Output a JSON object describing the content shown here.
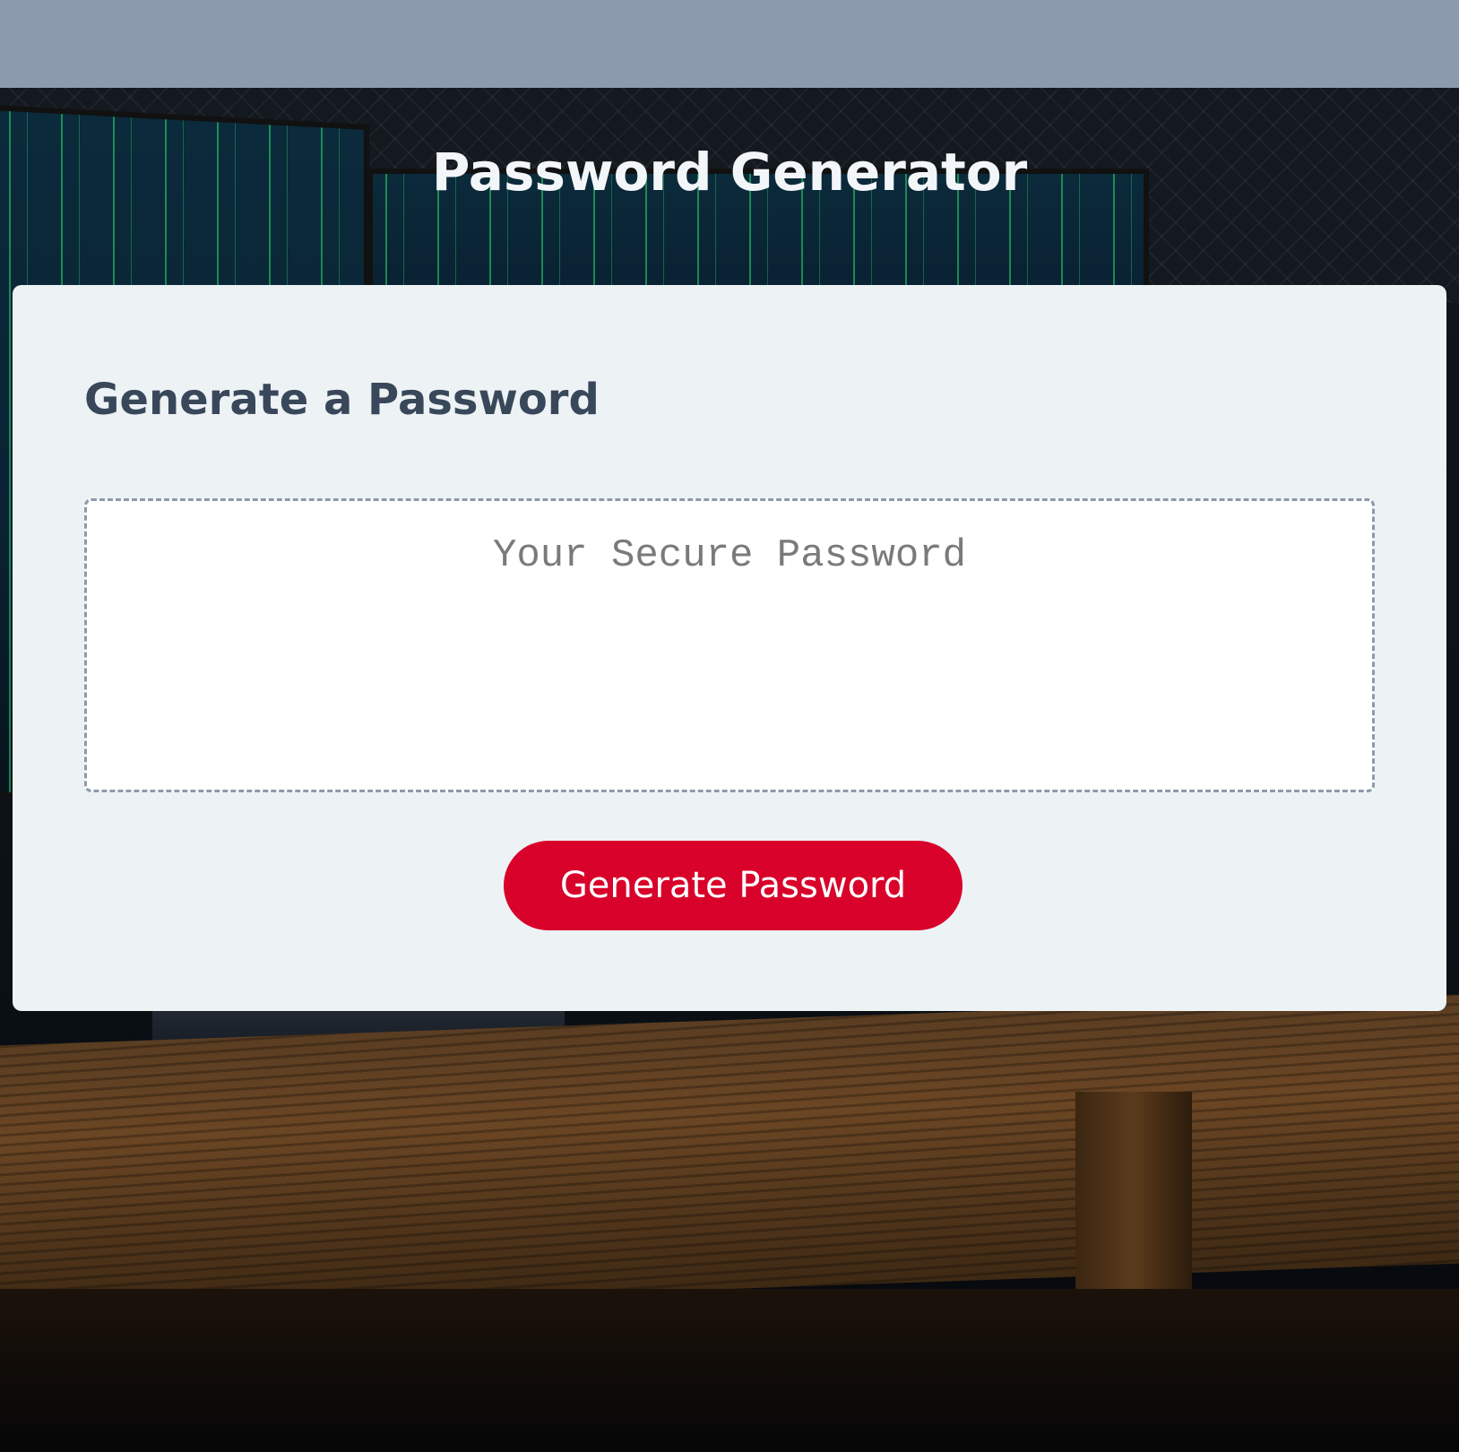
{
  "header": {
    "title": "Password Generator"
  },
  "card": {
    "heading": "Generate a Password",
    "password_field": {
      "placeholder": "Your Secure Password",
      "value": ""
    },
    "generate_button_label": "Generate Password"
  },
  "colors": {
    "top_strip": "#8c9aad",
    "card_background": "#edf2f5",
    "heading_text": "#39475a",
    "button_background": "#d8022a",
    "button_text": "#ffffff",
    "field_border": "#8e99aa"
  },
  "background_image": "desk-with-matrix-monitors"
}
